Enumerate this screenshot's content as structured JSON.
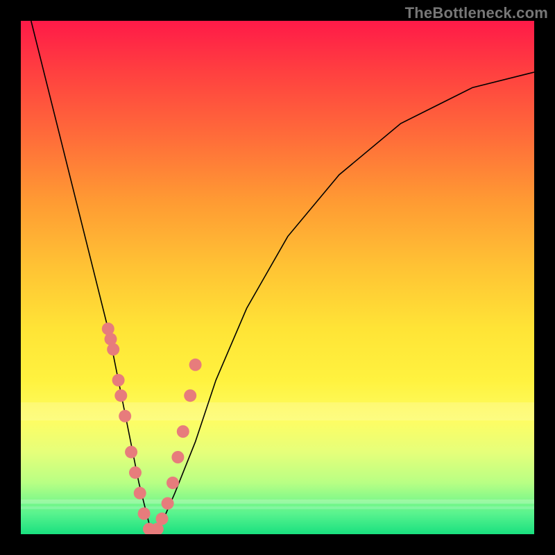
{
  "watermark": "TheBottleneck.com",
  "chart_data": {
    "type": "line",
    "title": "",
    "xlabel": "",
    "ylabel": "",
    "xlim": [
      0,
      100
    ],
    "ylim": [
      0,
      100
    ],
    "grid": false,
    "legend": false,
    "background": "gradient-red-yellow-green",
    "series": [
      {
        "name": "bottleneck-curve",
        "x": [
          2,
          5,
          8,
          11,
          14,
          17,
          19,
          21,
          23,
          25,
          26.5,
          30,
          34,
          38,
          44,
          52,
          62,
          74,
          88,
          100
        ],
        "values": [
          100,
          88,
          76,
          64,
          52,
          40,
          30,
          20,
          10,
          2,
          0,
          8,
          18,
          30,
          44,
          58,
          70,
          80,
          87,
          90
        ]
      }
    ],
    "scatter_points": {
      "name": "sample-dots",
      "x": [
        17.0,
        17.5,
        18.0,
        19.0,
        19.5,
        20.3,
        21.5,
        22.3,
        23.2,
        24.0,
        25.0,
        25.9,
        26.6,
        27.5,
        28.6,
        29.6,
        30.6,
        31.6,
        33.0,
        34.0
      ],
      "values": [
        40,
        38,
        36,
        30,
        27,
        23,
        16,
        12,
        8,
        4,
        1,
        0,
        1,
        3,
        6,
        10,
        15,
        20,
        27,
        33
      ]
    }
  }
}
